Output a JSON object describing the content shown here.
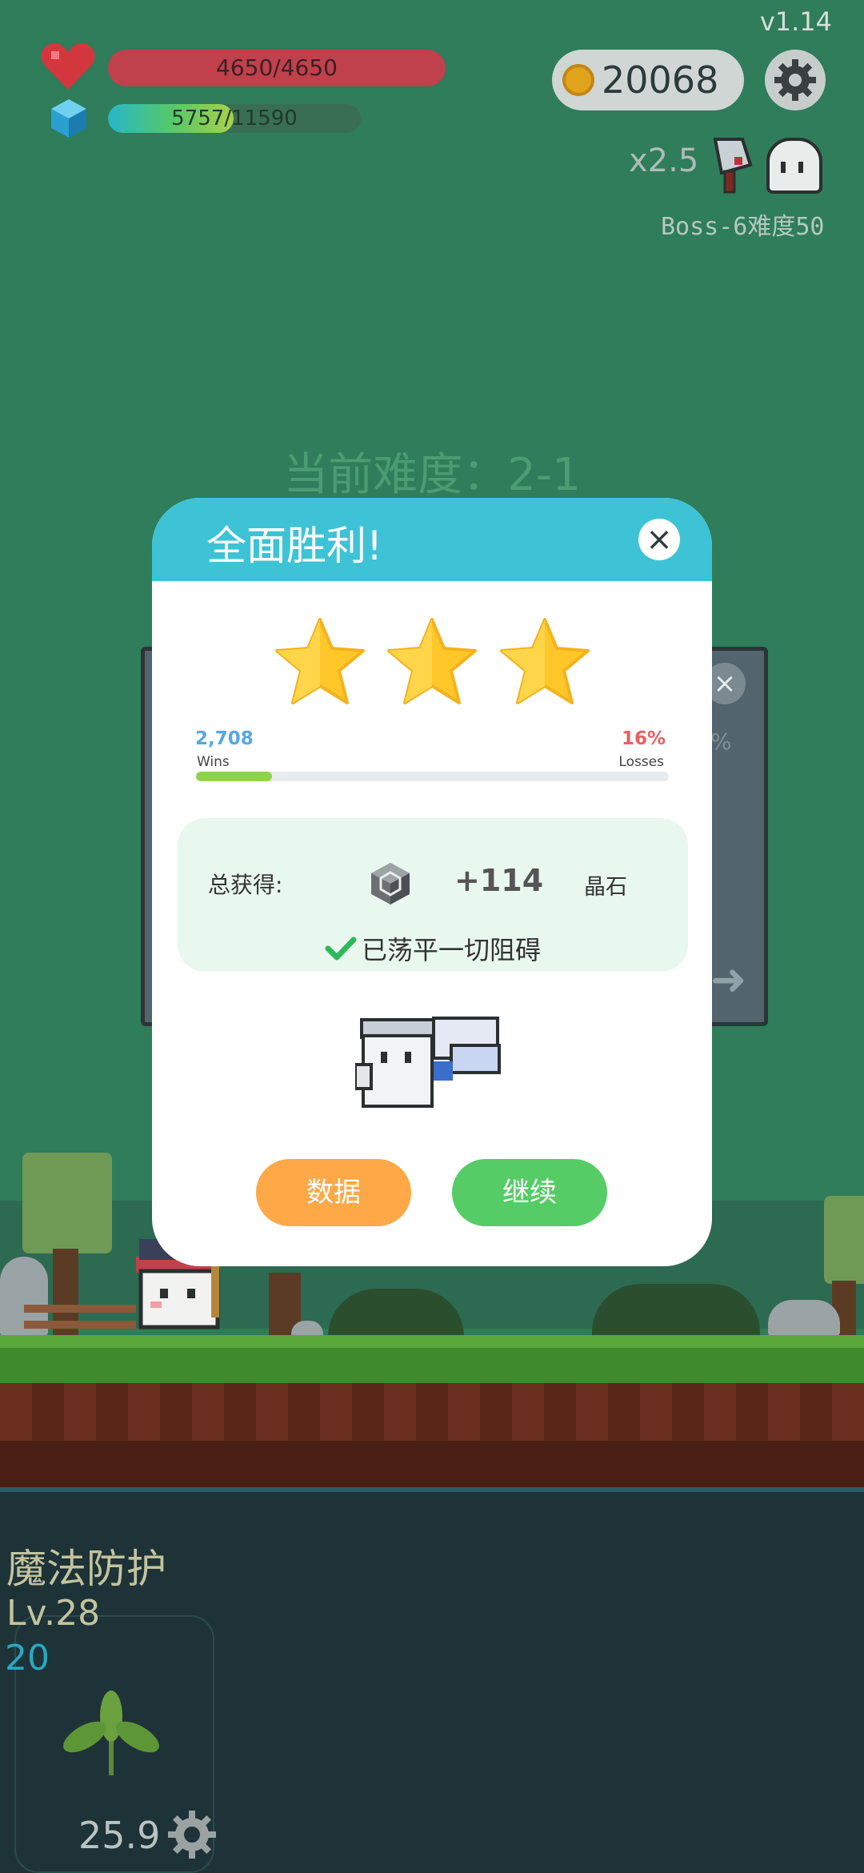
{
  "hud": {
    "version": "v1.14",
    "hp_text": "4650/4650",
    "xp_text": "5757/11590",
    "xp_fraction": 0.4967,
    "coins": "20068",
    "speed": "x2.5",
    "boss_info": "Boss-6难度50",
    "difficulty_title": "当前难度：2-1"
  },
  "icons": {
    "hp": "heart-icon",
    "xp": "gem-icon",
    "coin": "coin-icon",
    "settings": "gear-icon",
    "weapon": "cleaver-icon",
    "boss": "ghost-icon"
  },
  "dialog": {
    "title": "全面胜利!",
    "stars_earned": 3,
    "stars_total": 3,
    "wins_value": "2,708",
    "wins_label": "Wins",
    "losses_value": "16%",
    "losses_label": "Losses",
    "win_ratio_fraction": 0.16,
    "reward_label": "总获得:",
    "reward_value": "+114",
    "reward_unit": "晶石",
    "cleared_text": "已荡平一切阻碍",
    "button_data": "数据",
    "button_continue": "继续"
  },
  "skill": {
    "name": "魔法防护",
    "level": "Lv.28",
    "value": "20",
    "timer": "25.9"
  },
  "colors": {
    "header": "#3ec3d6",
    "button_data": "#ffa848",
    "button_continue": "#55cc66",
    "star": "#ffc729",
    "ratio_fill": "#8ed34a",
    "reward_box": "#e9f8ef"
  }
}
